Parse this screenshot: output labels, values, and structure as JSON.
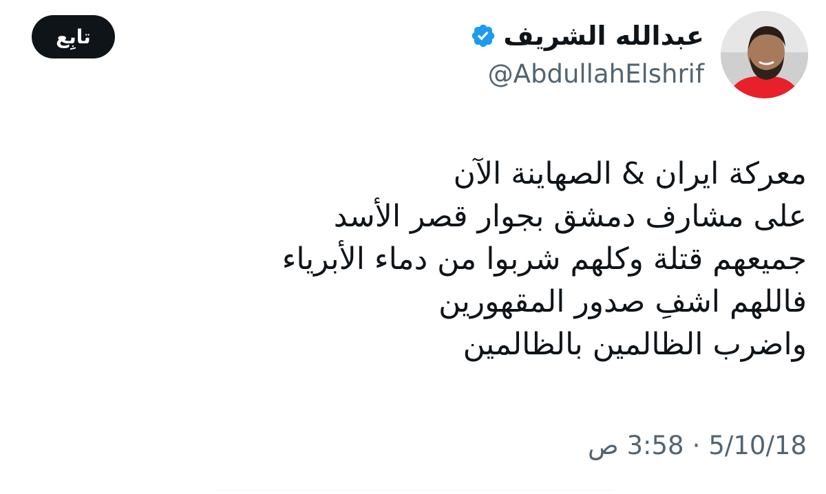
{
  "header": {
    "follow_label": "تابِع",
    "author_name": "عبدالله الشريف",
    "handle": "@AbdullahElshrif",
    "verified_icon": "verified-badge-icon",
    "verified_color": "#1d9bf0"
  },
  "tweet": {
    "lines": [
      "معركة ايران & الصهاينة الآن",
      "على مشارف دمشق بجوار قصر الأسد",
      "جميعهم قتلة وكلهم شربوا من دماء الأبرياء",
      "فاللهم اشفِ صدور المقهورين",
      "واضرب الظالمين بالظالمين"
    ]
  },
  "footer": {
    "time": "3:58 ص",
    "separator": "·",
    "date": "5/10/18"
  }
}
